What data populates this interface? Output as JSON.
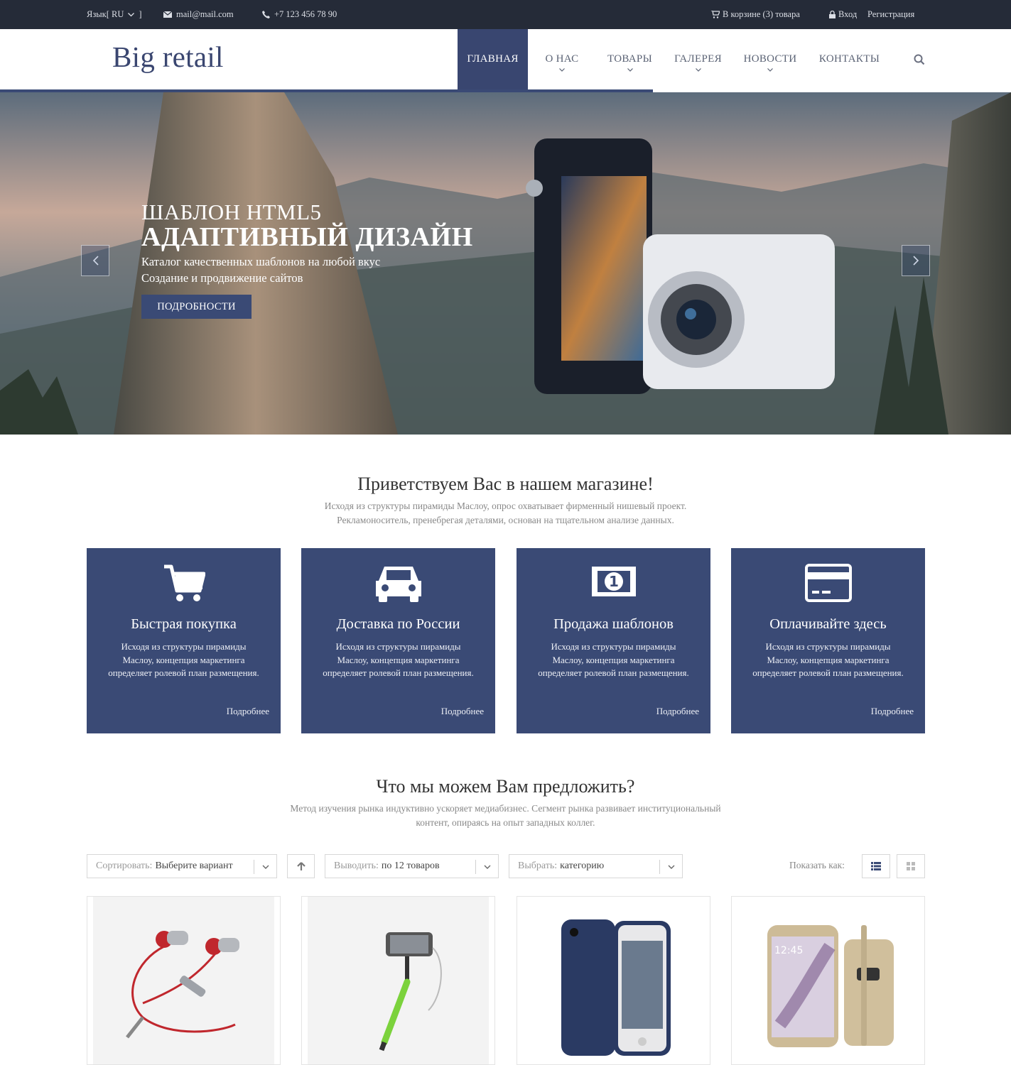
{
  "topbar": {
    "lang": "Язык[ RU",
    "lang_end": "]",
    "email": "mail@mail.com",
    "phone": "+7 123 456 78 90",
    "cart": "В корзине (3) товара",
    "login": "Вход",
    "register": "Регистрация"
  },
  "header": {
    "logo": "Big retail",
    "nav": [
      {
        "label": "ГЛАВНАЯ"
      },
      {
        "label": "О НАС"
      },
      {
        "label": "ТОВАРЫ"
      },
      {
        "label": "ГАЛЕРЕЯ"
      },
      {
        "label": "НОВОСТИ"
      },
      {
        "label": "КОНТАКТЫ"
      }
    ]
  },
  "hero": {
    "title_small": "ШАБЛОН HTML5",
    "title_big": "АДАПТИВНЫЙ ДИЗАЙН",
    "line1": "Каталог качественных шаблонов на любой вкус",
    "line2": "Создание и продвижение сайтов",
    "button": "ПОДРОБНОСТИ"
  },
  "welcome": {
    "title": "Приветствуем Вас в нашем магазине!",
    "text1": "Исходя из структуры пирамиды Маслоу, опрос охватывает фирменный нишевый проект.",
    "text2": "Рекламоноситель, пренебрегая деталями, основан на тщательном анализе данных."
  },
  "features": [
    {
      "icon": "cart-icon",
      "title": "Быстрая покупка",
      "text": "Исходя из структуры пирамиды Маслоу, концепция маркетинга определяет ролевой план размещения.",
      "more": "Подробнее"
    },
    {
      "icon": "car-icon",
      "title": "Доставка по России",
      "text": "Исходя из структуры пирамиды Маслоу, концепция маркетинга определяет ролевой план размещения.",
      "more": "Подробнее"
    },
    {
      "icon": "money-icon",
      "title": "Продажа шаблонов",
      "text": "Исходя из структуры пирамиды Маслоу, концепция маркетинга определяет ролевой план размещения.",
      "more": "Подробнее"
    },
    {
      "icon": "credit-card-icon",
      "title": "Оплачивайте здесь",
      "text": "Исходя из структуры пирамиды Маслоу, концепция маркетинга определяет ролевой план размещения.",
      "more": "Подробнее"
    }
  ],
  "offer": {
    "title": "Что мы можем Вам предложить?",
    "text1": "Метод изучения рынка индуктивно ускоряет медиабизнес. Сегмент рынка развивает институциональный",
    "text2": "контент, опираясь на опыт западных коллег."
  },
  "filters": {
    "sort_label": "Сортировать:",
    "sort_value": "Выберите вариант",
    "show_label": "Выводить:",
    "show_value": "по 12 товаров",
    "cat_label": "Выбрать:",
    "cat_value": "категорию",
    "view_label": "Показать как:"
  },
  "products": [
    {
      "name": "earphones"
    },
    {
      "name": "selfie-stick"
    },
    {
      "name": "phone-case"
    },
    {
      "name": "smartphone"
    }
  ],
  "colors": {
    "accent": "#3a4a75",
    "topbar": "#252b38"
  }
}
